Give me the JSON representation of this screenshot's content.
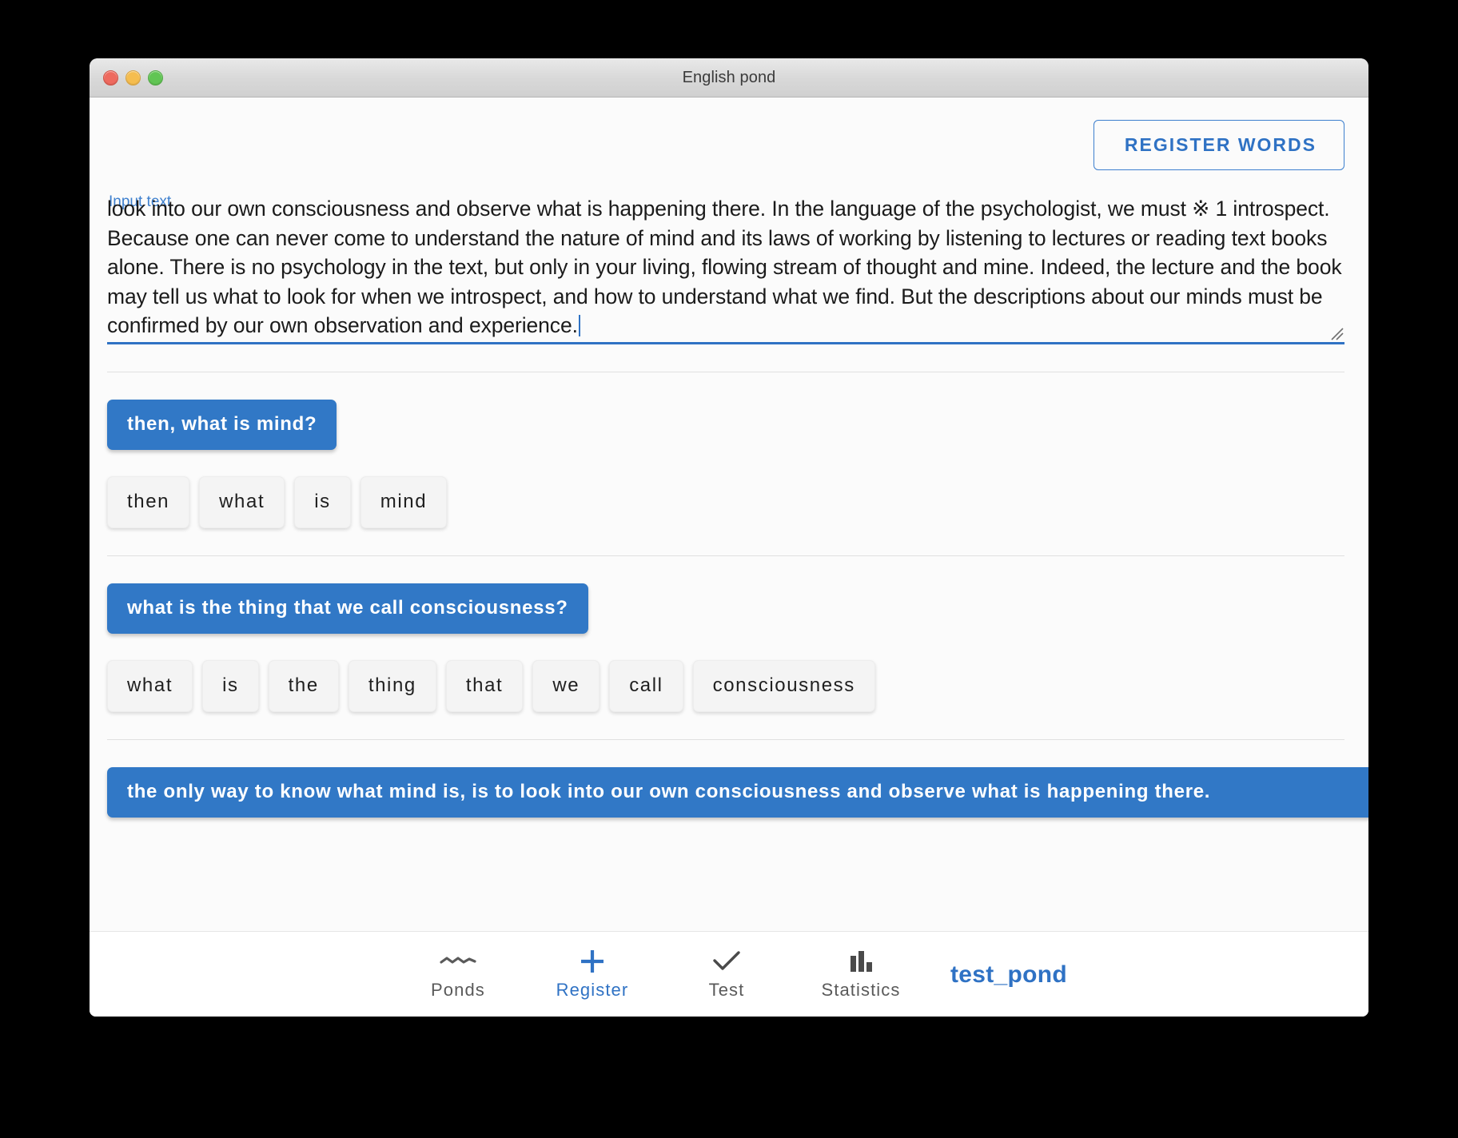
{
  "window": {
    "title": "English pond",
    "traffic_lights": [
      {
        "name": "close",
        "color": "#ee6a5f"
      },
      {
        "name": "minimize",
        "color": "#f5bd4f"
      },
      {
        "name": "zoom",
        "color": "#61c554"
      }
    ]
  },
  "colors": {
    "accent": "#2f72c4",
    "chip_blue": "#3178c6",
    "chip_grey": "#f4f4f4",
    "nav_inactive": "#5a5a5a"
  },
  "toolbar": {
    "register_words_label": "REGISTER WORDS"
  },
  "input": {
    "label": "Input text",
    "value": "look into our own consciousness and observe what is happening there. In the language of the psychologist, we must ※ 1 introspect. Because one can never come to understand the nature of mind and its laws of working by listening to lectures or reading text books alone. There is no psychology in the text, but only in your living, flowing stream of thought and mine. Indeed, the lecture and the book may tell us what to look for when we introspect, and how to understand what we find. But the descriptions about our minds must be confirmed by our own observation and experience.",
    "caret_visible": true,
    "resize_handle": "resize-grip"
  },
  "sentences": [
    {
      "text": "then, what is mind?",
      "words": [
        "then",
        "what",
        "is",
        "mind"
      ]
    },
    {
      "text": "what is the thing that we call consciousness?",
      "words": [
        "what",
        "is",
        "the",
        "thing",
        "that",
        "we",
        "call",
        "consciousness"
      ]
    },
    {
      "text": "the only way to know what mind is, is to look into our own consciousness and observe what is happening there.",
      "words": []
    }
  ],
  "bottom_nav": {
    "items": [
      {
        "label": "Ponds",
        "icon": "wave-icon",
        "active": false
      },
      {
        "label": "Register",
        "icon": "plus-icon",
        "active": true
      },
      {
        "label": "Test",
        "icon": "check-icon",
        "active": false
      },
      {
        "label": "Statistics",
        "icon": "bar-chart-icon",
        "active": false
      }
    ],
    "pond_name": "test_pond"
  }
}
